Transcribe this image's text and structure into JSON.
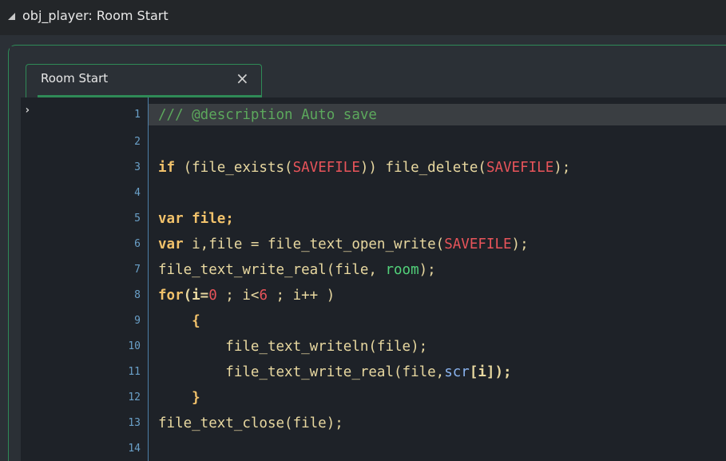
{
  "window": {
    "title": "obj_player: Room Start",
    "tab_label": "Room Start",
    "close_glyph": "×",
    "fold_glyph": "›"
  },
  "editor": {
    "line_numbers": [
      "1",
      "2",
      "3",
      "4",
      "5",
      "6",
      "7",
      "8",
      "9",
      "10",
      "11",
      "12",
      "13",
      "14"
    ],
    "lines": {
      "l1": "/// @description Auto save",
      "l3a": "if",
      "l3b": " (file_exists(",
      "l3c": "SAVEFILE",
      "l3d": ")) file_delete(",
      "l3e": "SAVEFILE",
      "l3f": ");",
      "l5a": "var",
      "l5b": " file;",
      "l6a": "var",
      "l6b": " i,file = file_text_open_write(",
      "l6c": "SAVEFILE",
      "l6d": ");",
      "l7a": "file_text_write_real(file, ",
      "l7b": "room",
      "l7c": ");",
      "l8a": "for",
      "l8b": "(i=",
      "l8c": "0",
      "l8d": " ; i<",
      "l8e": "6",
      "l8f": " ; i++ )",
      "l9": "    {",
      "l10": "        file_text_writeln(file);",
      "l11a": "        file_text_write_real(file,",
      "l11b": "scr",
      "l11c": "[i]);",
      "l12": "    }",
      "l13": "file_text_close(file);"
    }
  }
}
